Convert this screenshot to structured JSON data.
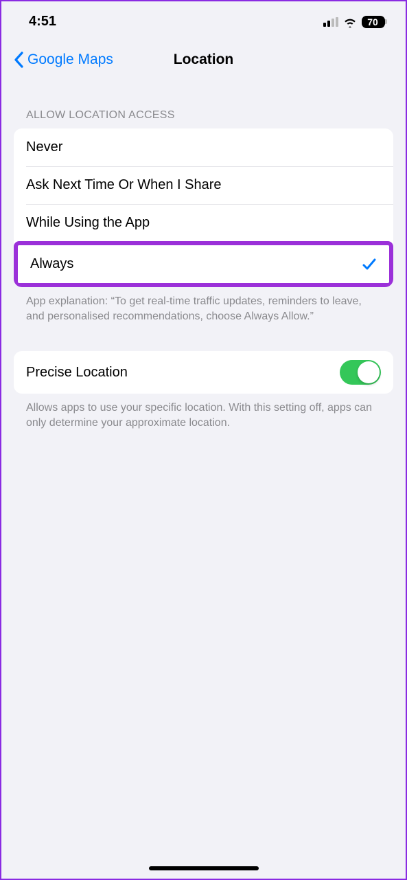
{
  "status": {
    "time": "4:51",
    "battery": "70"
  },
  "nav": {
    "back_label": "Google Maps",
    "title": "Location"
  },
  "section1": {
    "header": "ALLOW LOCATION ACCESS",
    "options": [
      "Never",
      "Ask Next Time Or When I Share",
      "While Using the App",
      "Always"
    ],
    "selected_index": 3,
    "footer": "App explanation: “To get real-time traffic updates, reminders to leave, and personalised recommendations, choose Always Allow.”"
  },
  "section2": {
    "precise_label": "Precise Location",
    "precise_on": true,
    "footer": "Allows apps to use your specific location. With this setting off, apps can only determine your approximate location."
  }
}
